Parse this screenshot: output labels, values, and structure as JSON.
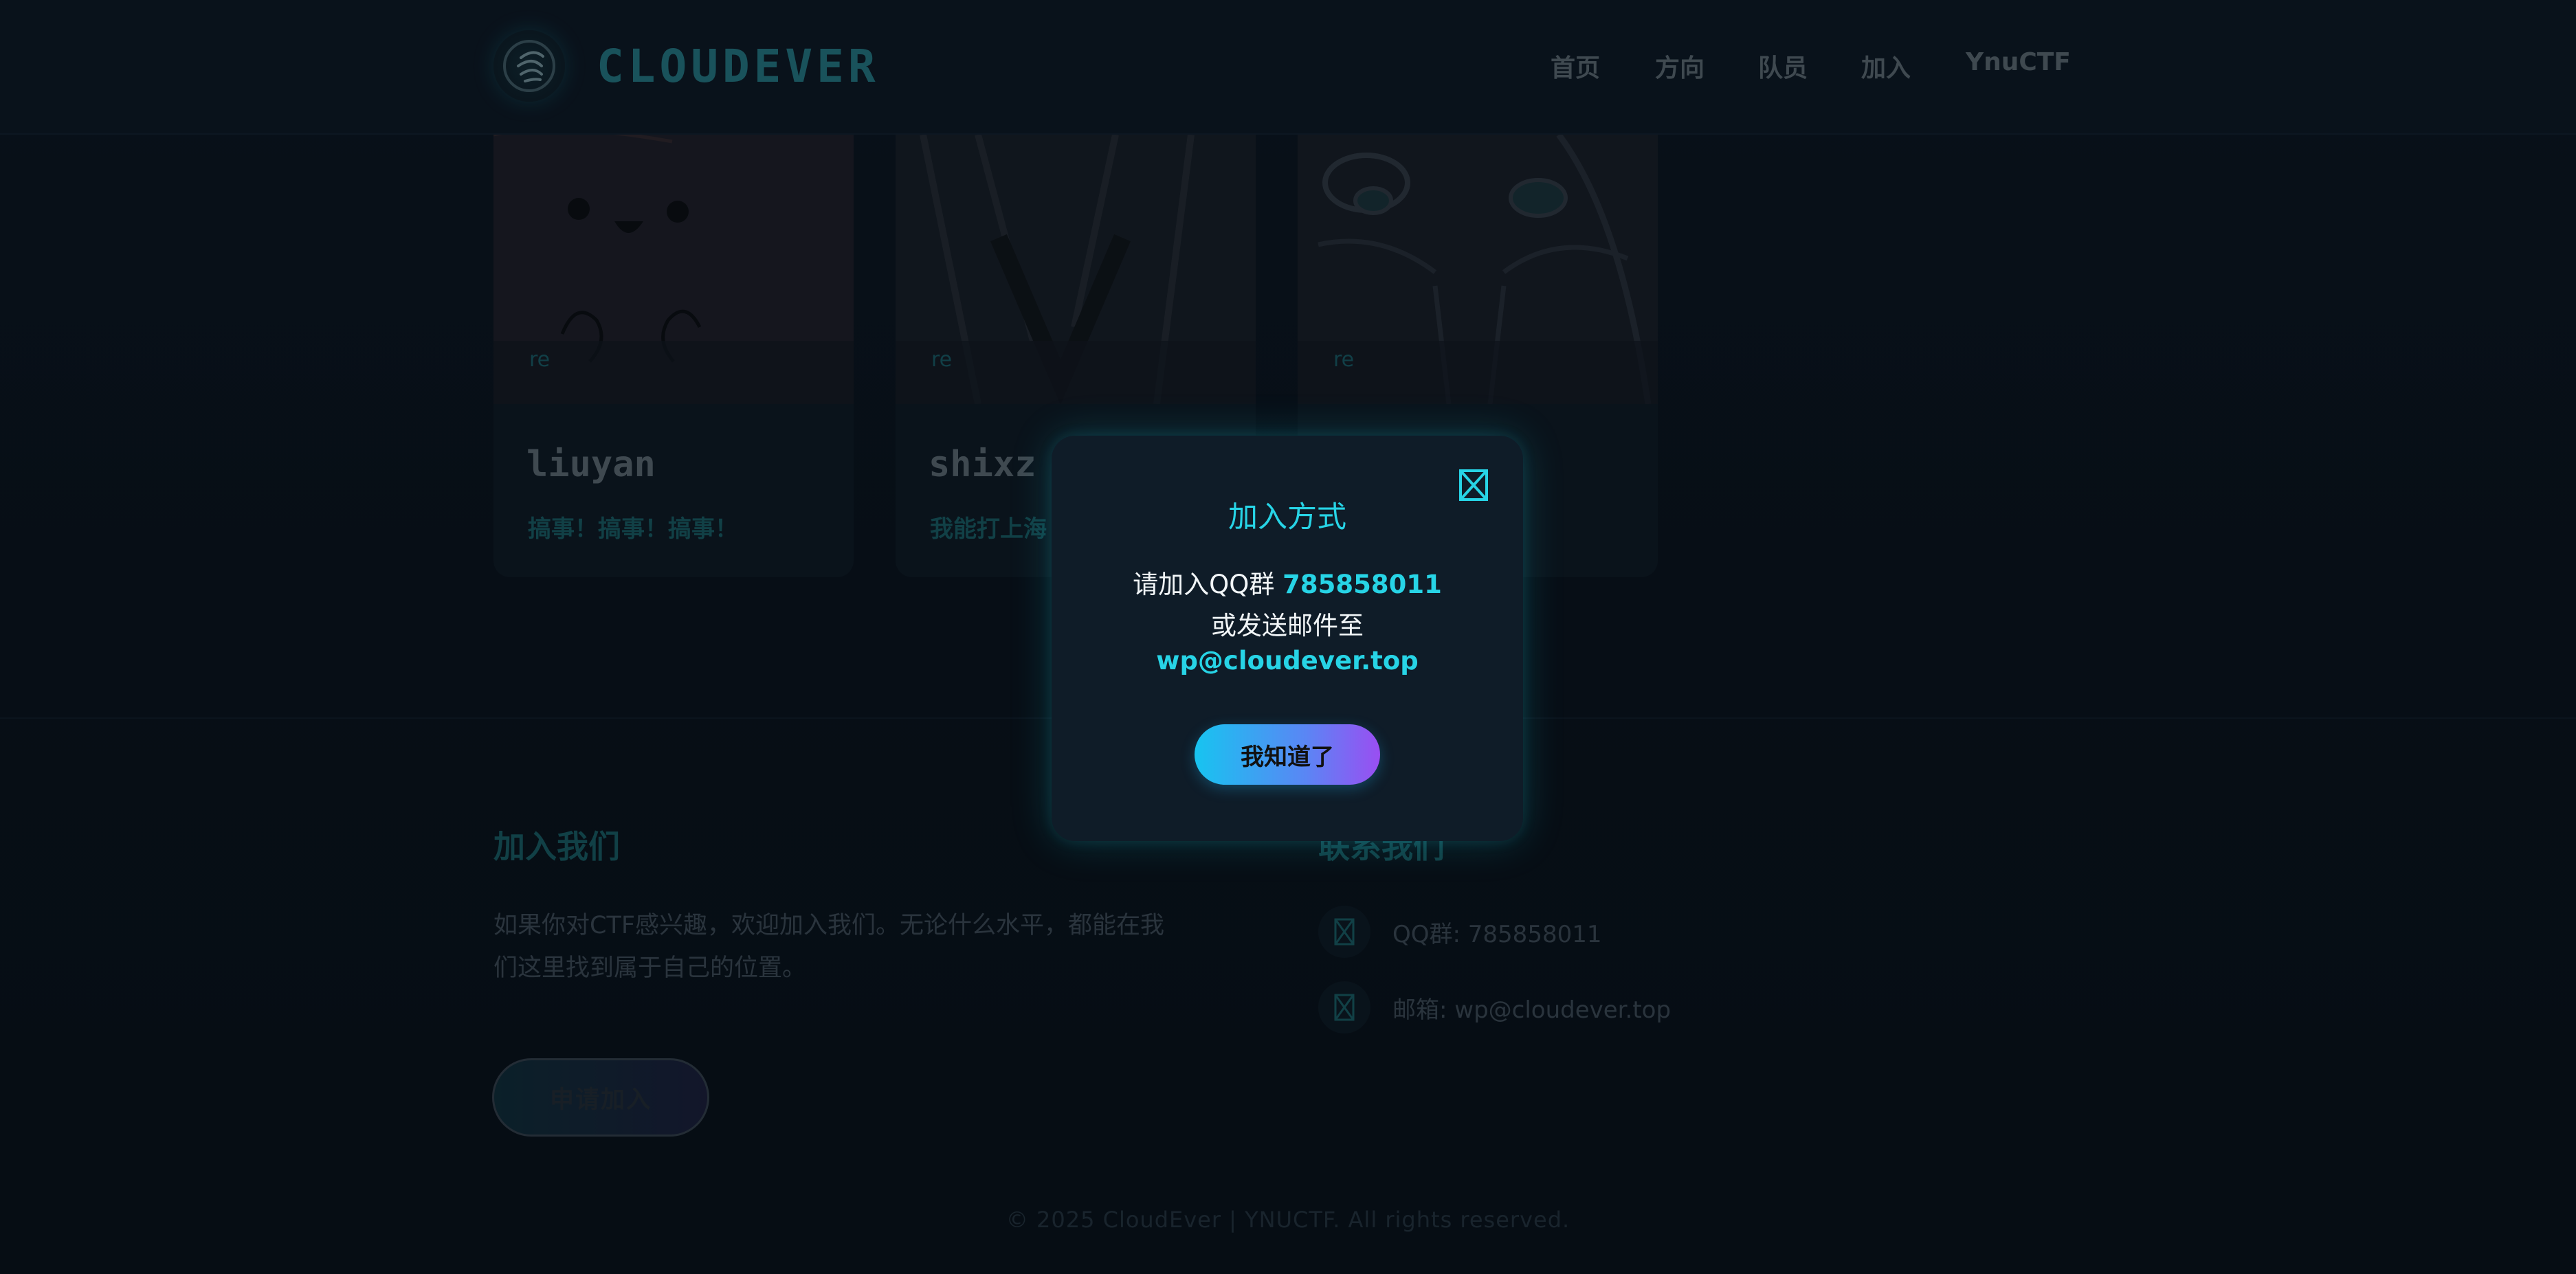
{
  "header": {
    "brand": "CLOUDEVER",
    "nav": [
      "首页",
      "方向",
      "队员",
      "加入",
      "YnuCTF"
    ]
  },
  "members": [
    {
      "tag": "re",
      "name": "liuyan",
      "motto": "搞事！搞事！搞事！"
    },
    {
      "tag": "re",
      "name": "shixz",
      "motto": "我能打上海"
    },
    {
      "tag": "re",
      "name": "",
      "motto": ""
    }
  ],
  "join": {
    "title": "加入我们",
    "description": "如果你对CTF感兴趣，欢迎加入我们。无论什么水平，都能在我们这里找到属于自己的位置。",
    "apply_label": "申请加入"
  },
  "contact": {
    "title": "联系我们",
    "items": [
      {
        "icon": "qq-icon",
        "text": "QQ群: 785858011"
      },
      {
        "icon": "mail-icon",
        "text": "邮箱: wp@cloudever.top"
      }
    ]
  },
  "footer": {
    "text": "© 2025 CloudEver | YNUCTF. All rights reserved."
  },
  "modal": {
    "title": "加入方式",
    "line1_prefix": "请加入QQ群 ",
    "qq_number": "785858011",
    "line2": "或发送邮件至",
    "email": "wp@cloudever.top",
    "ok_label": "我知道了"
  },
  "colors": {
    "accent": "#27d4e6",
    "background": "#0a121d",
    "button_gradient_start": "#17c4f0",
    "button_gradient_end": "#9a4ef2"
  }
}
